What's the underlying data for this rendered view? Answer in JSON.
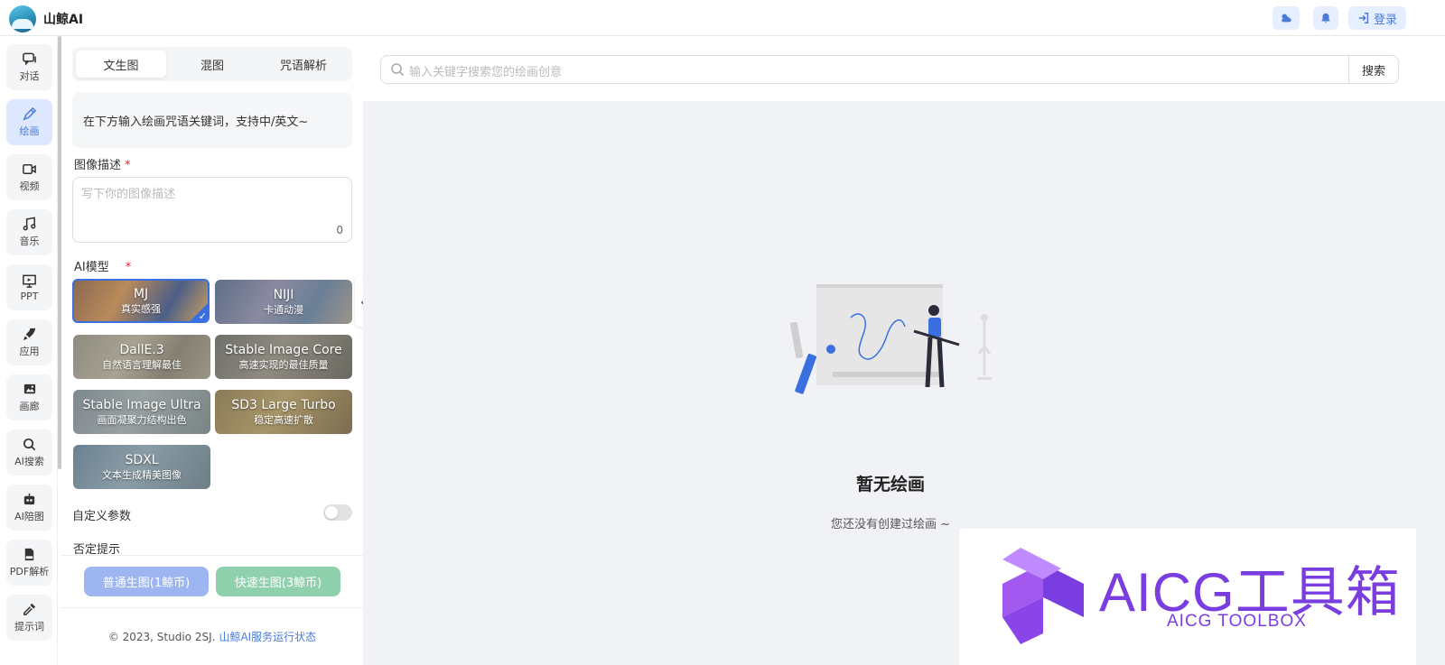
{
  "app": {
    "title": "山鲸AI"
  },
  "header": {
    "login_label": "登录"
  },
  "rail": {
    "items": [
      {
        "label": "对话",
        "icon": "chat-icon"
      },
      {
        "label": "绘画",
        "icon": "brush-icon"
      },
      {
        "label": "视频",
        "icon": "video-icon"
      },
      {
        "label": "音乐",
        "icon": "music-icon"
      },
      {
        "label": "PPT",
        "icon": "presentation-icon"
      },
      {
        "label": "应用",
        "icon": "rocket-icon"
      },
      {
        "label": "画廊",
        "icon": "gallery-icon"
      },
      {
        "label": "AI搜索",
        "icon": "search-icon"
      },
      {
        "label": "AI陪图",
        "icon": "robot-icon"
      },
      {
        "label": "PDF解析",
        "icon": "pdf-icon"
      },
      {
        "label": "提示词",
        "icon": "dropper-icon"
      }
    ]
  },
  "tabs": [
    "文生图",
    "混图",
    "咒语解析"
  ],
  "hint": "在下方输入绘画咒语关键词，支持中/英文~",
  "description": {
    "label": "图像描述",
    "required_mark": "*",
    "placeholder": "写下你的图像描述",
    "count": "0"
  },
  "model": {
    "label": "AI模型",
    "required_mark": "*",
    "cards": [
      {
        "name": "MJ",
        "sub": "真实感强"
      },
      {
        "name": "NIJI",
        "sub": "卡通动漫"
      },
      {
        "name": "DallE.3",
        "sub": "自然语言理解最佳"
      },
      {
        "name": "Stable Image Core",
        "sub": "高速实现的最佳质量"
      },
      {
        "name": "Stable Image Ultra",
        "sub": "画面凝聚力结构出色"
      },
      {
        "name": "SD3 Large Turbo",
        "sub": "稳定高速扩散"
      },
      {
        "name": "SDXL",
        "sub": "文本生成精美图像"
      }
    ]
  },
  "custom_params": "自定义参数",
  "negative_prompt": "否定提示",
  "buttons": {
    "normal": "普通生图(1鲸币)",
    "fast": "快速生图(3鲸币)"
  },
  "footer": {
    "copyright": "© 2023, Studio 2SJ.",
    "status_link": "山鲸AI服务运行状态"
  },
  "search": {
    "placeholder": "输入关键字搜索您的绘画创意",
    "button": "搜索"
  },
  "empty": {
    "title": "暂无绘画",
    "subtitle": "您还没有创建过绘画 ~"
  },
  "watermark": {
    "text": "AICG工具箱",
    "sub": "AICG TOOLBOX"
  },
  "colors": {
    "accent": "#4a7bd6",
    "watermark": "#7a3de0"
  }
}
